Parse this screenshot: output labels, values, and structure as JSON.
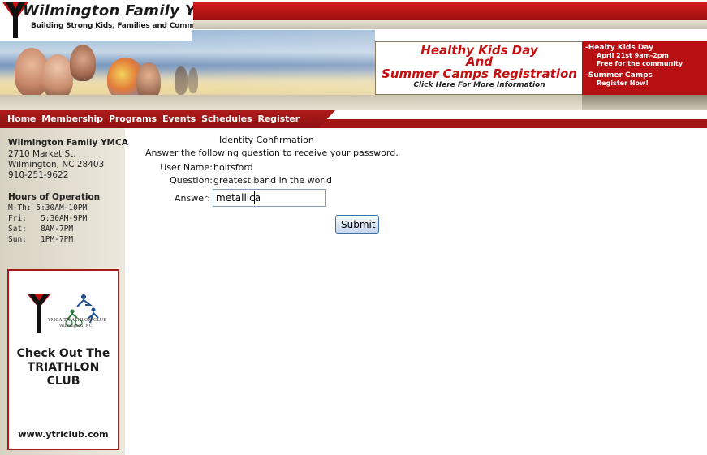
{
  "header": {
    "site_title": "Wilmington Family YMCA",
    "tagline": "Building Strong Kids, Families and Communities",
    "promo": {
      "line1": "Healthy Kids Day",
      "line2": "And",
      "line3": "Summer Camps Registration",
      "link_text": "Click Here For More Information"
    },
    "side_promo": {
      "item1": "-Healty Kids Day",
      "item1_detail1": "April 21st 9am-2pm",
      "item1_detail2": "Free for the community",
      "item2": "-Summer Camps",
      "item2_detail": "Register Now!"
    }
  },
  "nav": {
    "items": [
      "Home",
      "Membership",
      "Programs",
      "Events",
      "Schedules",
      "Register"
    ]
  },
  "sidebar": {
    "org_name": "Wilmington Family YMCA",
    "address": [
      "2710 Market St.",
      "Wilmington, NC 28403",
      "910-251-9622"
    ],
    "hours_title": "Hours of Operation",
    "hours": [
      {
        "day": "M-Th:",
        "time": "5:30AM-10PM"
      },
      {
        "day": "Fri:",
        "time": "5:30AM-9PM"
      },
      {
        "day": "Sat:",
        "time": "8AM-7PM"
      },
      {
        "day": "Sun:",
        "time": "1PM-7PM"
      }
    ],
    "ad": {
      "club_name": "YMCA TRIATHLON CLUB",
      "club_city": "Wilmington, NC",
      "heading": "Check Out The TRIATHLON CLUB",
      "url": "www.ytriclub.com"
    }
  },
  "form": {
    "title": "Identity Confirmation",
    "instructions": "Answer the following question to receive your password.",
    "username_label": "User Name:",
    "username_value": "holtsford",
    "question_label": "Question:",
    "question_value": "greatest band in the world",
    "answer_label": "Answer:",
    "answer_value": "metallica",
    "submit_label": "Submit"
  },
  "colors": {
    "brand_red": "#a31414",
    "promo_red": "#c41010",
    "sidebar_bg": "#e2ddd0"
  }
}
